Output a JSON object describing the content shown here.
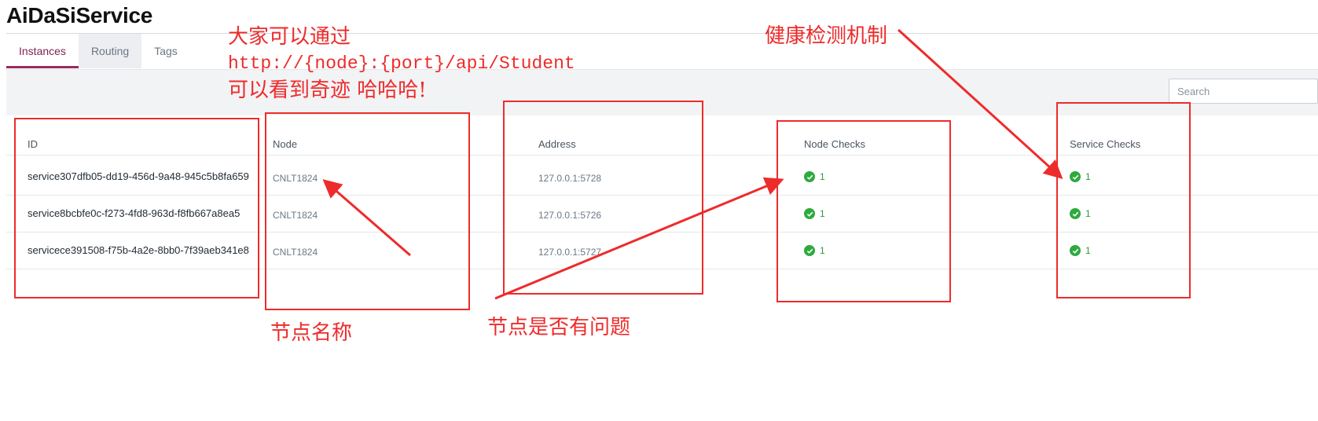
{
  "app": {
    "title": "AiDaSiService"
  },
  "tabs": [
    {
      "label": "Instances"
    },
    {
      "label": "Routing"
    },
    {
      "label": "Tags"
    }
  ],
  "search": {
    "placeholder": "Search",
    "value": ""
  },
  "table": {
    "headers": [
      "ID",
      "Node",
      "Address",
      "Node Checks",
      "Service Checks"
    ],
    "rows": [
      {
        "id": "service307dfb05-dd19-456d-9a48-945c5b8fa659",
        "node": "CNLT1824",
        "address": "127.0.0.1:5728",
        "node_checks": "1",
        "service_checks": "1"
      },
      {
        "id": "service8bcbfe0c-f273-4fd8-963d-f8fb667a8ea5",
        "node": "CNLT1824",
        "address": "127.0.0.1:5726",
        "node_checks": "1",
        "service_checks": "1"
      },
      {
        "id": "servicece391508-f75b-4a2e-8bb0-7f39aeb341e8",
        "node": "CNLT1824",
        "address": "127.0.0.1:5727",
        "node_checks": "1",
        "service_checks": "1"
      }
    ]
  },
  "annotations": {
    "line1": "大家可以通过",
    "line2": "http://{node}:{port}/api/Student",
    "line3": "可以看到奇迹 哈哈哈!",
    "health": "健康检测机制",
    "node_name": "节点名称",
    "node_problem": "节点是否有问题"
  },
  "colors": {
    "accent": "#9a2a61",
    "annotation_red": "#ee2b2b",
    "check_green": "#2eaa3f"
  },
  "icons": {
    "check": "check-circle-icon"
  }
}
